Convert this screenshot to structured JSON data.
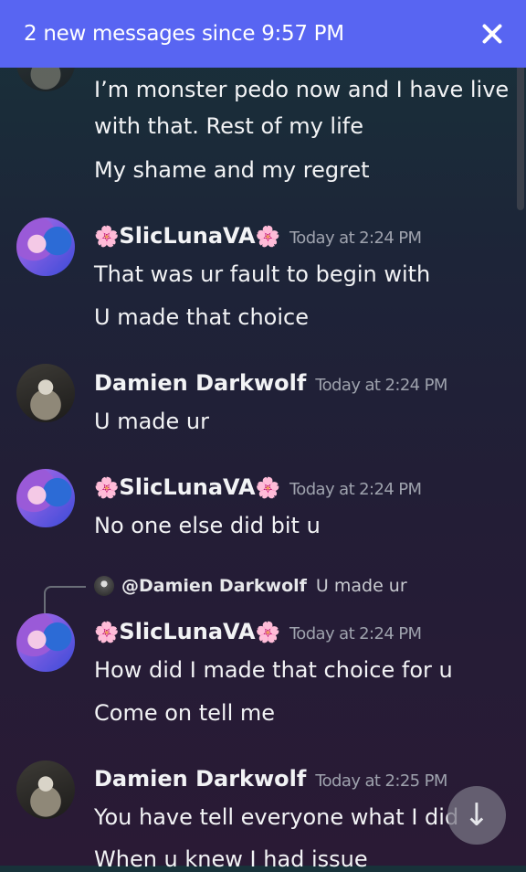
{
  "banner": {
    "text": "2 new messages since 9:57 PM",
    "close_icon": "close-icon"
  },
  "messages": [
    {
      "lines": [
        "I’m monster pedo now and I have live",
        "with that. Rest of my life",
        "My shame and my regret"
      ]
    },
    {
      "author": "SlicLunaVA",
      "time": "Today at 2:24 PM",
      "lines": [
        "That was ur fault to begin with",
        "U made that choice"
      ]
    },
    {
      "author": "Damien Darkwolf",
      "time": "Today at 2:24 PM",
      "lines": [
        "U made ur"
      ]
    },
    {
      "author": "SlicLunaVA",
      "time": "Today at 2:24 PM",
      "lines": [
        "No one else did bit u"
      ]
    },
    {
      "reply_to": {
        "mention": "@Damien Darkwolf",
        "text": "U made ur"
      },
      "author": "SlicLunaVA",
      "time": "Today at 2:24 PM",
      "lines": [
        "How did I made that choice for u",
        "Come on tell me"
      ]
    },
    {
      "author": "Damien Darkwolf",
      "time": "Today at 2:25 PM",
      "lines": [
        "You have tell everyone what I did",
        "When u knew I had issue"
      ]
    }
  ],
  "lotus": "🌸",
  "jump_icon": "arrow-down-icon",
  "colors": {
    "banner": "#5865f2",
    "timestamp": "#9ea2ad",
    "lotus": "#f47fb5"
  }
}
